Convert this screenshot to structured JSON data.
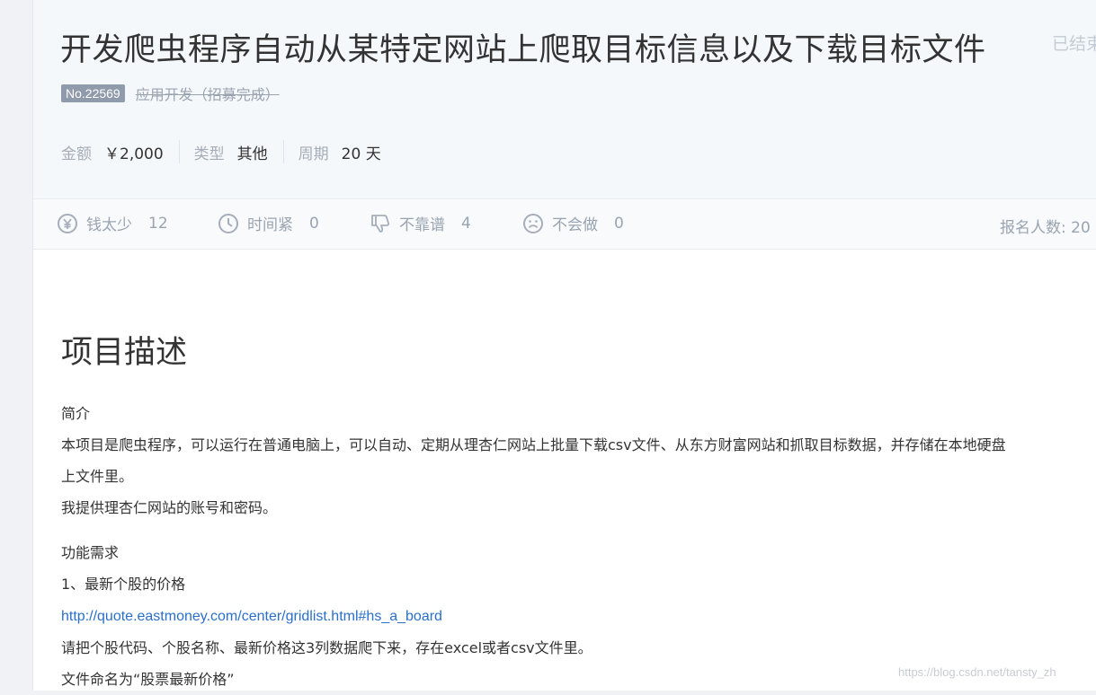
{
  "project": {
    "title": "开发爬虫程序自动从某特定网站上爬取目标信息以及下载目标文件",
    "status": "已结束",
    "number": "No.22569",
    "category": "应用开发（招募完成）"
  },
  "meta": {
    "amount_label": "金额",
    "amount_value": "￥2,000",
    "type_label": "类型",
    "type_value": "其他",
    "period_label": "周期",
    "period_value": "20 天"
  },
  "stats": {
    "items": [
      {
        "label": "钱太少",
        "count": "12",
        "icon": "yen-icon"
      },
      {
        "label": "时间紧",
        "count": "0",
        "icon": "clock-icon"
      },
      {
        "label": "不靠谱",
        "count": "4",
        "icon": "thumbs-down-icon"
      },
      {
        "label": "不会做",
        "count": "0",
        "icon": "sad-face-icon"
      }
    ],
    "signup_label": "报名人数:",
    "signup_count": "20"
  },
  "description": {
    "heading": "项目描述",
    "intro_label": "简介",
    "intro_line1": "本项目是爬虫程序，可以运行在普通电脑上，可以自动、定期从理杏仁网站上批量下载csv文件、从东方财富网站和抓取目标数据，并存储在本地硬盘",
    "intro_line2": "上文件里。",
    "intro_line3": "我提供理杏仁网站的账号和密码。",
    "requirements_label": "功能需求",
    "req1_title": "1、最新个股的价格",
    "req1_link": "http://quote.eastmoney.com/center/gridlist.html#hs_a_board",
    "req1_desc": "请把个股代码、个股名称、最新价格这3列数据爬下来，存在excel或者csv文件里。",
    "req1_filename": "文件命名为“股票最新价格”"
  },
  "watermark": "https://blog.csdn.net/tansty_zh",
  "colors": {
    "header_bg": "#f5f8fb",
    "badge_bg": "#8f9aab",
    "link": "#2a6fc9",
    "muted": "#9aa4b1"
  }
}
